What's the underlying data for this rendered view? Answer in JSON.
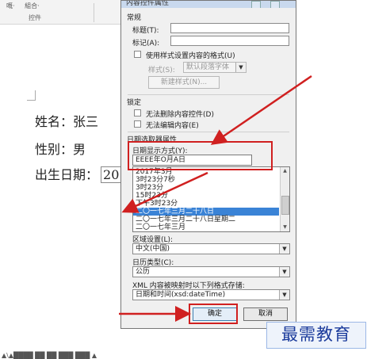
{
  "ribbon": {
    "item1": "嘅·",
    "item2": "組合·",
    "group_label": "控件"
  },
  "document": {
    "name_line": "姓名：张三",
    "gender_line": "性别：男",
    "birth_label": "出生日期：",
    "birth_frag": "20",
    "bottom_text": "▲\\▲████ ██ ██ ███ ███ ▲"
  },
  "dialog": {
    "title": "内容控件属性",
    "general_heading": "常规",
    "title_label": "标题(T):",
    "tag_label": "标记(A):",
    "use_style_label": "使用样式设置内容的格式(U)",
    "style_label": "样式(S):",
    "style_value": "默认段落字体",
    "new_style_button": "新建样式(N)...",
    "lock_heading": "锁定",
    "lock_delete_label": "无法删除内容控件(D)",
    "lock_edit_label": "无法编辑内容(E)",
    "date_picker_heading": "日期选取器属性",
    "date_format_label": "日期显示方式(Y):",
    "date_format_value": "EEEE年O月A日",
    "date_formats": [
      "2017年3月",
      "3时23分7秒",
      "3时23分",
      "15时23分",
      "下午3时23分",
      "二〇一七年三月二十八日",
      "二〇一七年三月二十八日星期二",
      "二〇一七年三月"
    ],
    "selected_index": 5,
    "locale_label": "区域设置(L):",
    "locale_value": "中文(中国)",
    "calendar_label": "日历类型(C):",
    "calendar_value": "公历",
    "xml_label": "XML 内容被映射时以下列格式存储:",
    "xml_value": "日期和时间(xsd:dateTime)",
    "ok_button": "确定",
    "cancel_button": "取消"
  },
  "watermark": "最需教育",
  "colors": {
    "highlight": "#d02020",
    "selection": "#3a83d6",
    "watermark_text": "#1c3c9c"
  }
}
